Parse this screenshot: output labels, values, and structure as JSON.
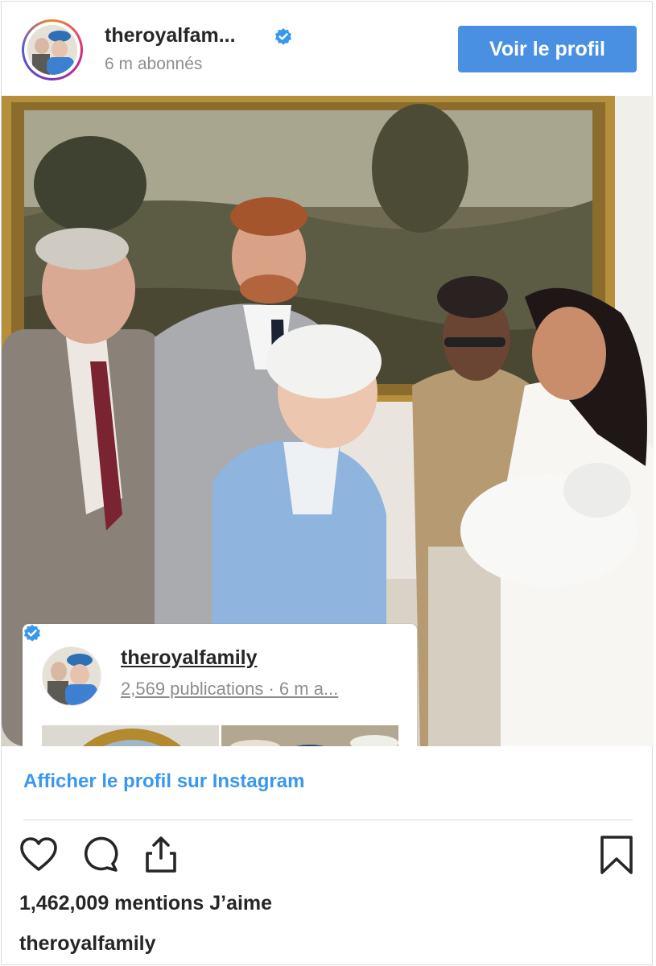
{
  "header": {
    "username": "theroyalfam...",
    "followers": "6 m abonnés",
    "profile_button": "Voir le profil"
  },
  "embed": {
    "username": "theroyalfamily",
    "meta": "2,569 publications · 6 m a..."
  },
  "link_text": "Afficher le profil sur Instagram",
  "likes": "1,462,009 mentions J’aime",
  "caption_user": "theroyalfamily",
  "colors": {
    "accent": "#4a90e2",
    "link": "#3897f0",
    "verified": "#3897f0",
    "text": "#262626",
    "muted": "#8e8e8e"
  },
  "icons": [
    "verified-badge-icon",
    "heart-icon",
    "comment-icon",
    "share-icon",
    "bookmark-icon"
  ]
}
